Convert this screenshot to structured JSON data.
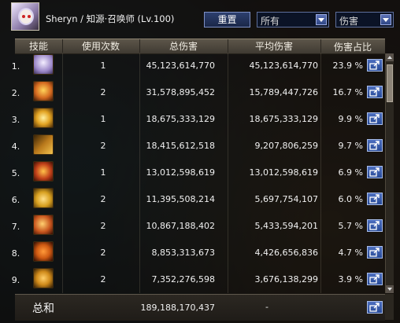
{
  "header": {
    "character_name": "Sheryn / 知源·召唤师 (Lv.100)",
    "reset_label": "重置",
    "filter_all": "所有",
    "filter_damage": "伤害"
  },
  "columns": {
    "skill": "技能",
    "uses": "使用次数",
    "total": "总伤害",
    "avg": "平均伤害",
    "share": "伤害占比"
  },
  "rows": [
    {
      "num": "1.",
      "uses": "1",
      "total": "45,123,614,770",
      "avg": "45,123,614,770",
      "pct": "23.9 %",
      "icon": "summon-skill-icon-1",
      "color": "#c7b6e8"
    },
    {
      "num": "2.",
      "uses": "2",
      "total": "31,578,895,452",
      "avg": "15,789,447,726",
      "pct": "16.7 %",
      "icon": "summon-skill-icon-2",
      "color": "#d46a20"
    },
    {
      "num": "3.",
      "uses": "1",
      "total": "18,675,333,129",
      "avg": "18,675,333,129",
      "pct": "9.9 %",
      "icon": "summon-skill-icon-3",
      "color": "#e2a322"
    },
    {
      "num": "4.",
      "uses": "2",
      "total": "18,415,612,518",
      "avg": "9,207,806,259",
      "pct": "9.7 %",
      "icon": "summon-skill-icon-4",
      "color": "#b9791c"
    },
    {
      "num": "5.",
      "uses": "1",
      "total": "13,012,598,619",
      "avg": "13,012,598,619",
      "pct": "6.9 %",
      "icon": "summon-skill-icon-5",
      "color": "#c2421a"
    },
    {
      "num": "6.",
      "uses": "2",
      "total": "11,395,508,214",
      "avg": "5,697,754,107",
      "pct": "6.0 %",
      "icon": "summon-skill-icon-6",
      "color": "#d8a020"
    },
    {
      "num": "7.",
      "uses": "2",
      "total": "10,867,188,402",
      "avg": "5,433,594,201",
      "pct": "5.7 %",
      "icon": "summon-skill-icon-7",
      "color": "#c8561e"
    },
    {
      "num": "8.",
      "uses": "2",
      "total": "8,853,313,673",
      "avg": "4,426,656,836",
      "pct": "4.7 %",
      "icon": "summon-skill-icon-8",
      "color": "#cf5a12"
    },
    {
      "num": "9.",
      "uses": "2",
      "total": "7,352,276,598",
      "avg": "3,676,138,299",
      "pct": "3.9 %",
      "icon": "summon-skill-icon-9",
      "color": "#cf8a1a"
    }
  ],
  "footer": {
    "sum_label": "总和",
    "sum_total": "189,188,170,437",
    "sum_avg": "-"
  }
}
